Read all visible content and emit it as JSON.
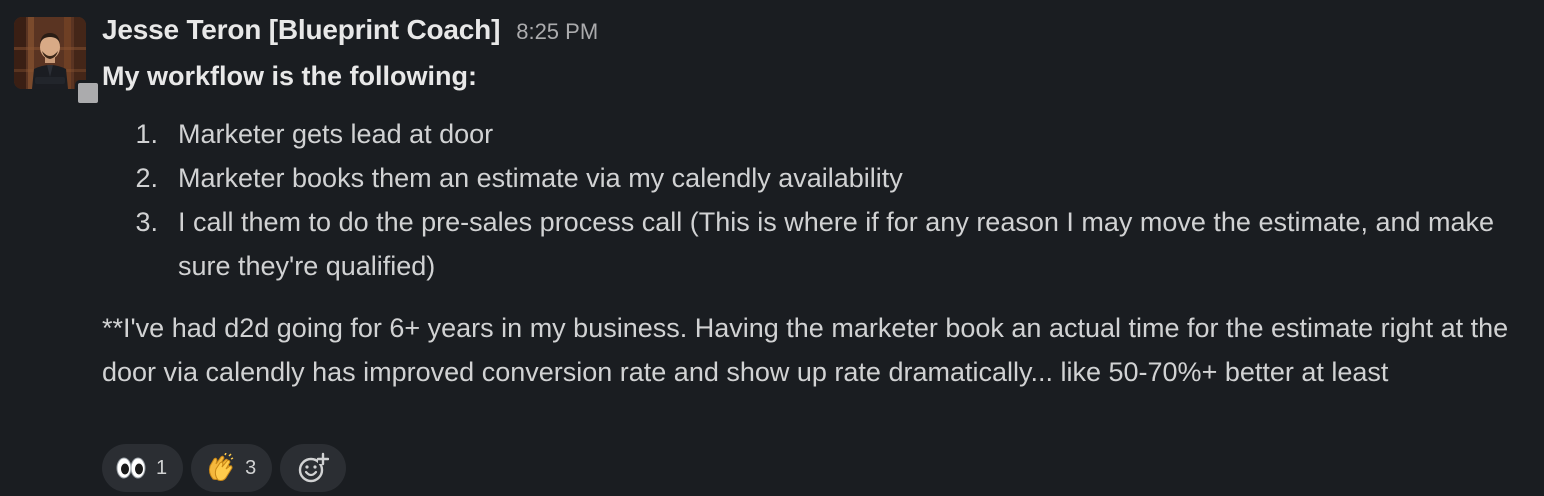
{
  "message": {
    "sender": "Jesse Teron [Blueprint Coach]",
    "timestamp": "8:25 PM",
    "intro": "My workflow is the following:",
    "steps": [
      {
        "num": "1.",
        "text": "Marketer gets lead at door"
      },
      {
        "num": "2.",
        "text": "Marketer books them an estimate via my calendly availability"
      },
      {
        "num": "3.",
        "text": "I call them to do the pre-sales process call (This is where if for any reason I may move the estimate, and make sure they're qualified)"
      }
    ],
    "paragraph": "**I've had d2d going for 6+ years in my business. Having the marketer book an actual time for the estimate right at the door via calendly has improved conversion rate and show up rate dramatically... like 50-70%+ better at least"
  },
  "reactions": [
    {
      "emoji": "eyes-icon",
      "count": "1"
    },
    {
      "emoji": "clapping-hands-icon",
      "count": "3"
    }
  ],
  "add_reaction": {
    "icon": "add-reaction-icon"
  },
  "colors": {
    "background": "#1a1d21",
    "text": "#d1d2d3",
    "name": "#e8e8e8",
    "muted": "#ababad",
    "pill": "#2b2e33",
    "presence": "#ababad"
  }
}
